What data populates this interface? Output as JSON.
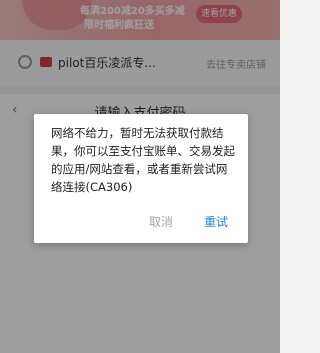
{
  "banner": {
    "line1": "每满200减20多买多减",
    "line2": "限时福利疯狂送",
    "pill": "速看优惠"
  },
  "shop": {
    "name": "pilot百乐凌派专...",
    "store_link": "去往专卖店铺"
  },
  "pay_sheet": {
    "title": "请输入支付密码"
  },
  "dialog": {
    "message": "网络不给力，暂时无法获取付款结果，你可以至支付宝账单、交易发起的应用/网站查看，或者重新尝试网络连接(CA306)",
    "cancel_label": "取消",
    "retry_label": "重试"
  },
  "colors": {
    "accent": "#1e88e5",
    "overlay": "rgba(0,0,0,0.38)"
  }
}
